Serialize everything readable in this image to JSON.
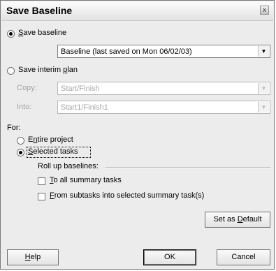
{
  "dialog": {
    "title": "Save Baseline",
    "close_symbol": "x"
  },
  "save_baseline": {
    "option_pre": "",
    "option_accel": "S",
    "option_rest": "ave baseline",
    "selected": true,
    "dropdown_value": "Baseline (last saved on Mon 06/02/03)"
  },
  "save_interim": {
    "option_pre": "Save interim ",
    "option_accel": "p",
    "option_rest": "lan",
    "selected": false,
    "copy_label": "Copy:",
    "copy_value": "Start/Finish",
    "into_label": "Into:",
    "into_value": "Start1/Finish1"
  },
  "for_section": {
    "label": "For:",
    "entire_project_pre": "E",
    "entire_project_accel": "n",
    "entire_project_rest": "tire project",
    "selected_tasks_pre": "",
    "selected_tasks_accel": "S",
    "selected_tasks_rest": "elected tasks",
    "selected_option": "selected-tasks"
  },
  "rollup": {
    "label": "Roll up baselines:",
    "to_all_pre": "",
    "to_all_accel": "T",
    "to_all_rest": "o all summary tasks",
    "from_sub_pre": "",
    "from_sub_accel": "F",
    "from_sub_rest": "rom subtasks into selected summary task(s)"
  },
  "buttons": {
    "set_default_pre": "Set as ",
    "set_default_accel": "D",
    "set_default_rest": "efault",
    "help_pre": "",
    "help_accel": "H",
    "help_rest": "elp",
    "ok": "OK",
    "cancel": "Cancel"
  },
  "icons": {
    "dropdown": "chevron-down-icon",
    "close": "close-icon"
  }
}
